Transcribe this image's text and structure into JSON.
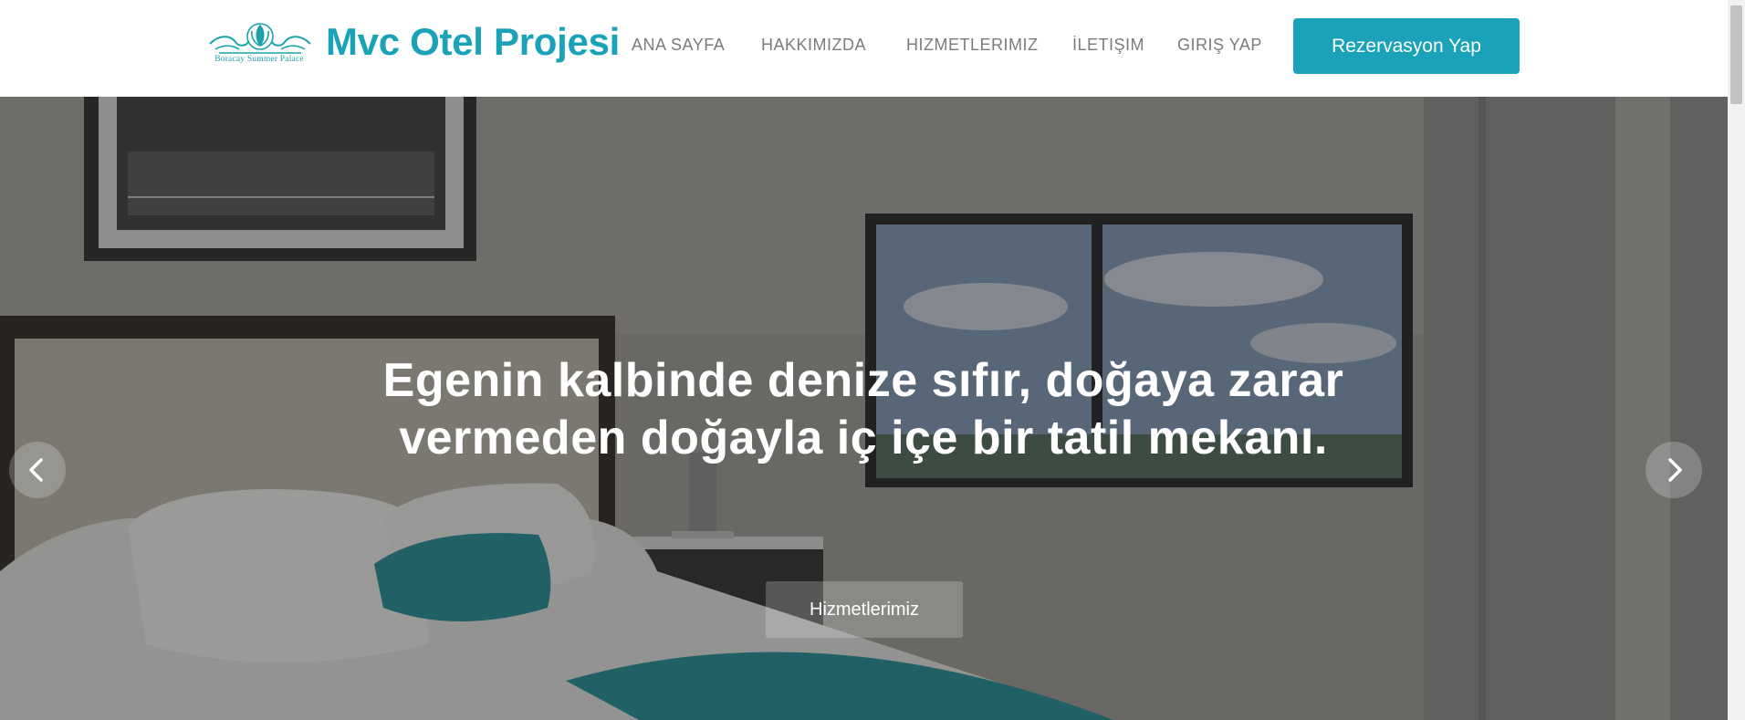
{
  "header": {
    "logo_caption": "Boracay Summer Palace",
    "brand": "Mvc Otel Projesi",
    "nav": [
      {
        "label": "ANA SAYFA"
      },
      {
        "label": "HAKKIMIZDA"
      },
      {
        "label": "HIZMETLERIMIZ"
      },
      {
        "label": "İLETIŞIM"
      },
      {
        "label": "GIRIŞ YAP"
      }
    ],
    "cta_label": "Rezervasyon Yap"
  },
  "hero": {
    "title": "Egenin kalbinde denize sıfır, doğaya zarar vermeden doğayla iç içe bir tatil mekanı.",
    "button_label": "Hizmetlerimiz"
  },
  "colors": {
    "accent": "#1aa3b8",
    "nav_text": "#7b7b7b",
    "hero_overlay": "rgba(40,40,40,0.45)"
  },
  "icons": {
    "prev": "chevron-left-icon",
    "next": "chevron-right-icon",
    "logo": "lotus-logo-icon"
  }
}
